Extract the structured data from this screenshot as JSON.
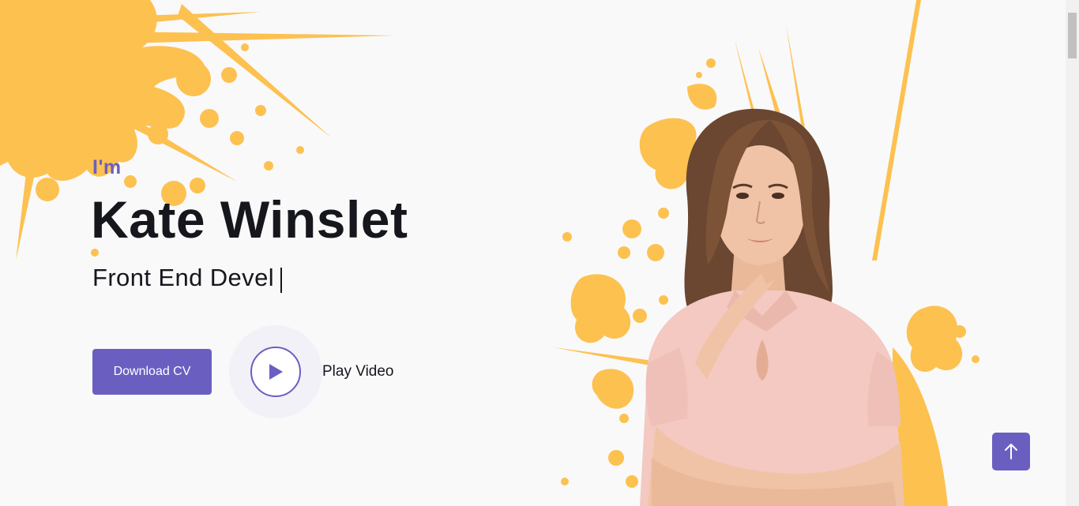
{
  "hero": {
    "greeting": "I'm",
    "name": "Kate Winslet",
    "role_typed": "Front End Devel",
    "download_label": "Download CV",
    "play_label": "Play Video"
  },
  "icons": {
    "play": "play-icon",
    "scroll_top": "arrow-up-icon"
  },
  "colors": {
    "accent": "#6a5fc1",
    "splash": "#fdc150",
    "text": "#16171d",
    "background": "#f9f9fa"
  }
}
